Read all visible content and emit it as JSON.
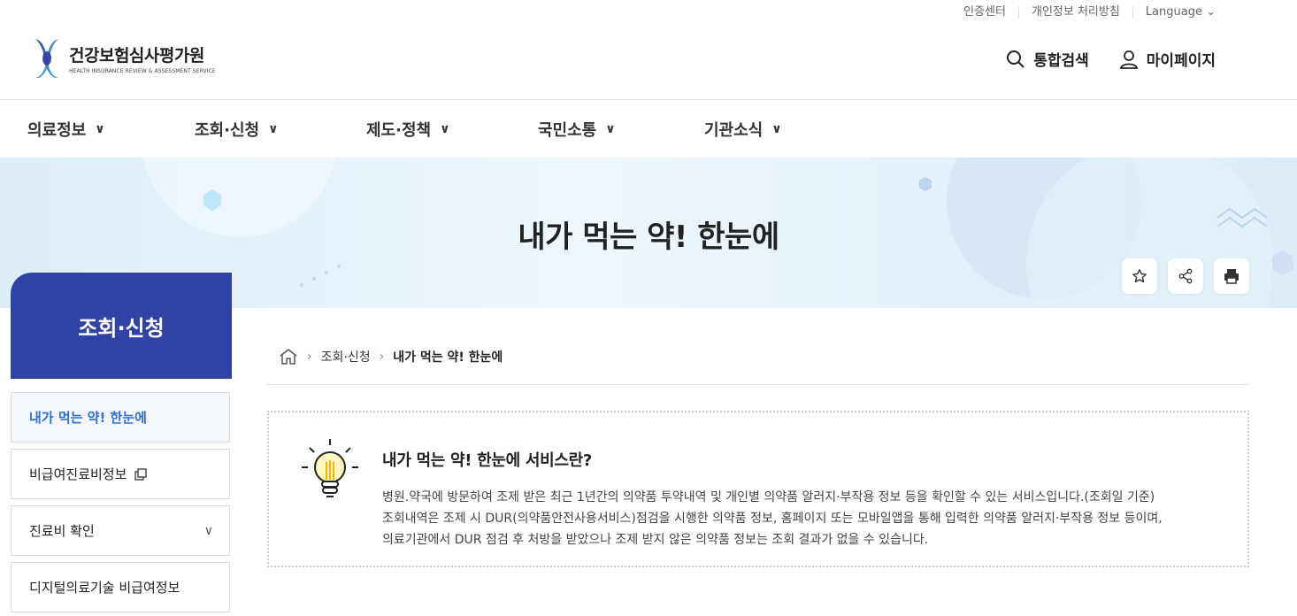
{
  "util_links": [
    "인증센터",
    "개인정보 처리방침",
    "Language"
  ],
  "logo": {
    "name_ko": "건강보험심사평가원",
    "name_en": "HEALTH INSURANCE REVIEW & ASSESSMENT SERVICE"
  },
  "top_actions": {
    "search": "통합검색",
    "mypage": "마이페이지"
  },
  "gnb": [
    "의료정보",
    "조회·신청",
    "제도·정책",
    "국민소통",
    "기관소식"
  ],
  "page_title": "내가 먹는 약! 한눈에",
  "tools": [
    "star-icon",
    "share-icon",
    "print-icon"
  ],
  "lnb": {
    "title": "조회·신청",
    "items": [
      "내가 먹는 약! 한눈에",
      "비급여진료비정보",
      "진료비 확인",
      "디지털의료기술 비급여정보"
    ]
  },
  "breadcrumb": {
    "level1": "조회·신청",
    "current": "내가 먹는 약! 한눈에"
  },
  "info": {
    "title": "내가 먹는 약! 한눈에 서비스란?",
    "lines": [
      "병원.약국에 방문하여 조제 받은 최근 1년간의 의약품 투약내역 및 개인별 의약품 알러지·부작용 정보 등을 확인할 수 있는 서비스입니다.(조회일 기준)",
      "조회내역은 조제 시 DUR(의약품안전사용서비스)점검을 시행한 의약품 정보, 홈페이지 또는 모바일앱을 통해 입력한 의약품 알러지·부작용 정보 등이며,",
      "의료기관에서 DUR 점검 후 처방을 받았으나 조제 받지 않은 의약품 정보는 조회 결과가 없을 수 있습니다."
    ]
  },
  "colors": {
    "accent": "#2f43a5",
    "active_text": "#2f6fd3"
  }
}
